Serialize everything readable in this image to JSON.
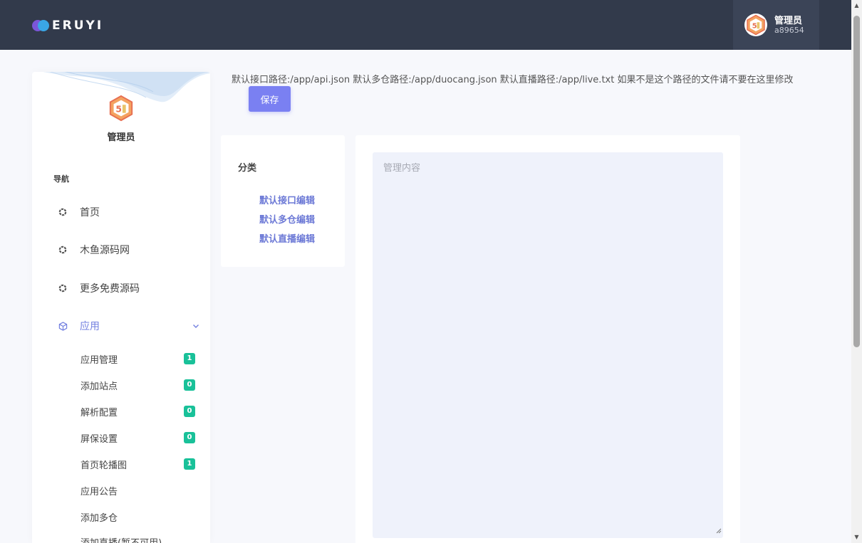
{
  "header": {
    "logo_text": "ERUYI",
    "user_name": "管理员",
    "user_id": "a89654"
  },
  "sidebar": {
    "profile_name": "管理员",
    "nav_title": "导航",
    "items": [
      {
        "label": "首页",
        "icon": "loader-icon"
      },
      {
        "label": "木鱼源码网",
        "icon": "loader-icon"
      },
      {
        "label": "更多免费源码",
        "icon": "loader-icon"
      },
      {
        "label": "应用",
        "icon": "box-icon",
        "expanded": true
      }
    ],
    "sub_items": [
      {
        "label": "应用管理",
        "badge": "1"
      },
      {
        "label": "添加站点",
        "badge": "0"
      },
      {
        "label": "解析配置",
        "badge": "0"
      },
      {
        "label": "屏保设置",
        "badge": "0"
      },
      {
        "label": "首页轮播图",
        "badge": "1"
      },
      {
        "label": "应用公告",
        "badge": ""
      },
      {
        "label": "添加多仓",
        "badge": ""
      },
      {
        "label": "添加直播(暂不可用)",
        "badge": ""
      }
    ]
  },
  "main": {
    "notice": "默认接口路径:/app/api.json 默认多仓路径:/app/duocang.json 默认直播路径:/app/live.txt 如果不是这个路径的文件请不要在这里修改",
    "save_label": "保存",
    "category_title": "分类",
    "category_links": [
      "默认接口编辑",
      "默认多仓编辑",
      "默认直播编辑"
    ],
    "content_placeholder": "管理内容"
  },
  "colors": {
    "header_bg": "#323a4b",
    "accent": "#7a80f2",
    "link": "#6c79d6",
    "badge": "#19c199"
  }
}
